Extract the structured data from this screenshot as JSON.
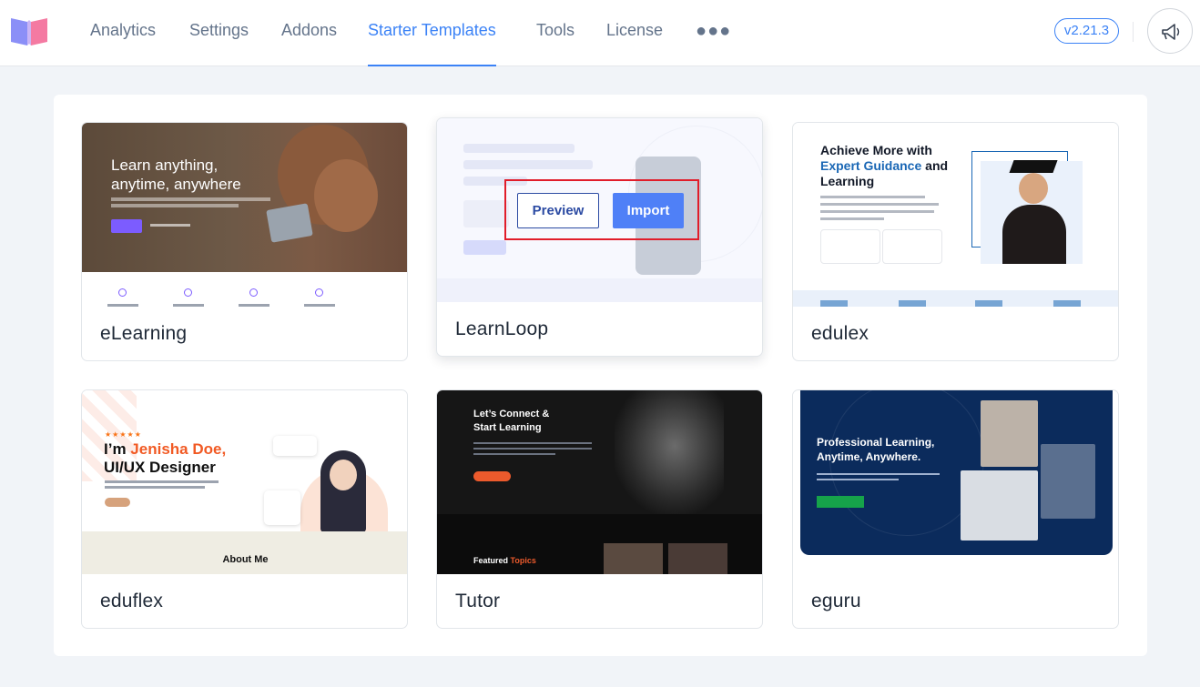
{
  "nav": {
    "items": [
      {
        "label": "Analytics",
        "active": false
      },
      {
        "label": "Settings",
        "active": false
      },
      {
        "label": "Addons",
        "active": false
      },
      {
        "label": "Starter Templates",
        "active": true
      },
      {
        "label": "Tools",
        "active": false
      },
      {
        "label": "License",
        "active": false
      }
    ],
    "more_icon": "more-horizontal-icon",
    "version": "v2.21.3",
    "announcement_icon": "megaphone-icon"
  },
  "colors": {
    "accent": "#3b82f6",
    "nav_text": "#64748b",
    "highlight_border": "#e11d2a",
    "import_button": "#4f80f7"
  },
  "templates": [
    {
      "name": "eLearning",
      "thumbnail": {
        "headline": "Learn anything, anytime, anywhere"
      }
    },
    {
      "name": "LearnLoop",
      "hovered": true,
      "actions": {
        "preview": "Preview",
        "import": "Import"
      }
    },
    {
      "name": "edulex",
      "thumbnail": {
        "headline_part1": "Achieve More with",
        "headline_accent": "Expert Guidance",
        "headline_part2": "and Learning"
      }
    },
    {
      "name": "eduflex",
      "thumbnail": {
        "rating": "★★★★★",
        "headline_part1": "I’m ",
        "headline_accent": "Jenisha Doe,",
        "headline_part2": "UI/UX Designer",
        "section": "About Me"
      }
    },
    {
      "name": "Tutor",
      "thumbnail": {
        "headline": "Let’s Connect & Start Learning",
        "featured_prefix": "Featured ",
        "featured_accent": "Topics"
      }
    },
    {
      "name": "eguru",
      "thumbnail": {
        "headline": "Professional Learning, Anytime, Anywhere."
      }
    }
  ]
}
